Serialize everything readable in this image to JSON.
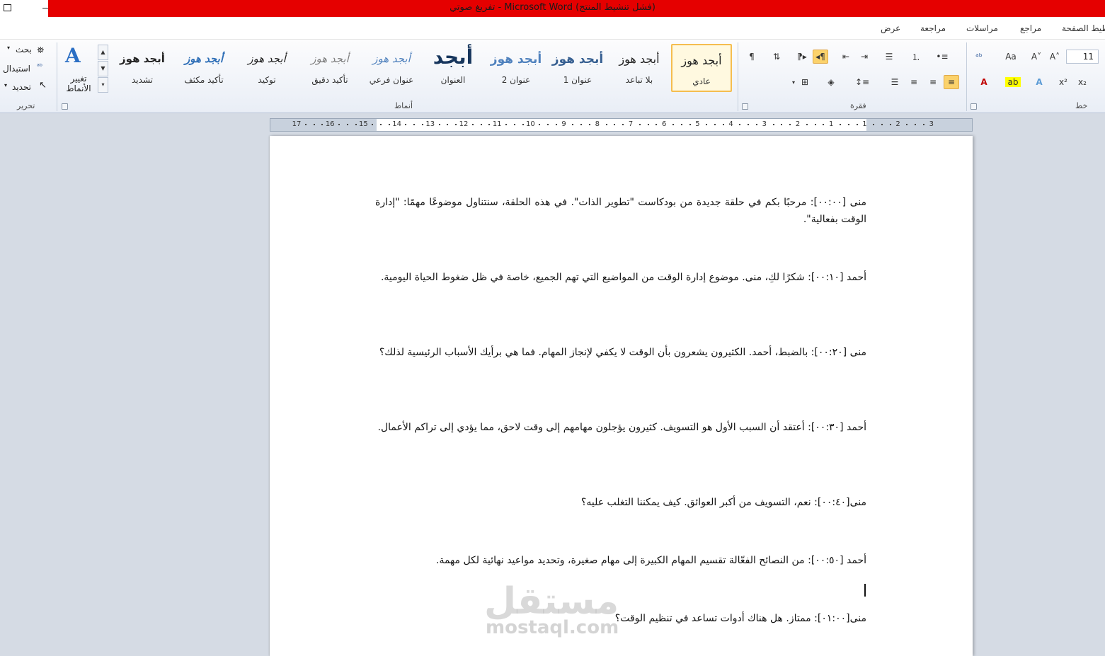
{
  "window": {
    "title": "تفريغ صوتي - Microsoft Word (فشل تنشيط المنتج)"
  },
  "menu": {
    "tabs": [
      "عرض",
      "مراجعة",
      "مراسلات",
      "مراجع",
      "تخطيط الصفحة"
    ]
  },
  "ribbon": {
    "editing": {
      "label": "تحرير",
      "find": "بحث",
      "replace": "استبدال",
      "select": "تحديد"
    },
    "change_styles": "تغيير الأنماط",
    "styles_label": "أنماط",
    "styles": [
      {
        "name": "عادي",
        "sample": "أبجد هوز",
        "selected": true
      },
      {
        "name": "بلا تباعد",
        "sample": "أبجد هوز"
      },
      {
        "name": "عنوان 1",
        "sample": "أبجد هوز"
      },
      {
        "name": "عنوان 2",
        "sample": "أبجد هوز"
      },
      {
        "name": "العنوان",
        "sample": "أبجد"
      },
      {
        "name": "عنوان فرعي",
        "sample": "أبجد هوز"
      },
      {
        "name": "تأكيد دقيق",
        "sample": "أبجد هوز"
      },
      {
        "name": "توكيد",
        "sample": "أبجد هوز"
      },
      {
        "name": "تأكيد مكثف",
        "sample": "أبجد هوز"
      },
      {
        "name": "تشديد",
        "sample": "أبجد هوز"
      }
    ],
    "paragraph_label": "فقرة",
    "font_label": "خط",
    "font_size": "11"
  },
  "ruler": {
    "numbers": [
      "17",
      "16",
      "15",
      "14",
      "13",
      "12",
      "11",
      "10",
      "9",
      "8",
      "7",
      "6",
      "5",
      "4",
      "3",
      "2",
      "1",
      "1",
      "2",
      "3"
    ]
  },
  "document": {
    "paragraphs": [
      {
        "speaker": "منى",
        "time": "[٠٠:٠٠]",
        "text": ": مرحبًا بكم في حلقة جديدة من بودكاست \"تطوير الذات\". في هذه الحلقة، سنتناول موضوعًا مهمًا: \"إدارة الوقت بفعالية\"."
      },
      {
        "speaker": "أحمد",
        "time": "[٠٠:١٠]",
        "text": ": شكرًا لكِ، منى. موضوع إدارة الوقت من المواضيع التي تهم الجميع، خاصة في ظل ضغوط الحياة اليومية."
      },
      {
        "speaker": "منى",
        "time": "[٠٠:٢٠]",
        "text": ": بالضبط، أحمد. الكثيرون يشعرون بأن الوقت لا يكفي لإنجاز المهام. فما هي برأيك الأسباب الرئيسية لذلك؟"
      },
      {
        "speaker": "أحمد",
        "time": "[٠٠:٣٠]",
        "text": ": أعتقد أن السبب الأول هو التسويف. كثيرون يؤجلون مهامهم إلى وقت لاحق، مما يؤدي إلى تراكم الأعمال."
      },
      {
        "speaker": "منى",
        "time": "[٠٠:٤٠]",
        "text": ": نعم، التسويف من أكبر العوائق. كيف يمكننا التغلب عليه؟"
      },
      {
        "speaker": "أحمد",
        "time": "[٠٠:٥٠]",
        "text": ": من النصائح الفعّالة تقسيم المهام الكبيرة إلى مهام صغيرة، وتحديد مواعيد نهائية لكل مهمة."
      },
      {
        "speaker": "منى",
        "time": "[٠١:٠٠]",
        "text": ": ممتاز. هل هناك أدوات تساعد في تنظيم الوقت؟"
      }
    ]
  },
  "watermark": {
    "arabic": "مستقل",
    "latin": "mostaql.com"
  }
}
